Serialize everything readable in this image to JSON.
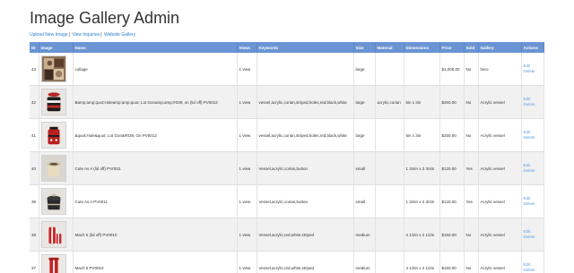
{
  "page": {
    "title": "Image Gallery Admin",
    "nav": {
      "upload": "Upload New Image",
      "inquiries": "View Inquiries",
      "website": "Website Gallery",
      "sep": "|"
    }
  },
  "table": {
    "headers": [
      "ID",
      "Image",
      "Name",
      "Views",
      "Keywords",
      "Size",
      "Material",
      "Dimensions",
      "Price",
      "Sold",
      "Gallery",
      "Actions"
    ],
    "rows": [
      {
        "id": "43",
        "name": "collage",
        "views": "1 view",
        "keywords": "",
        "size": "large",
        "material": "",
        "dimensions": "",
        "price": "$1,000.00",
        "sold": "No",
        "gallery": "hero",
        "edit": "Edit",
        "delete": "Delete",
        "thumb": "collage-thumbnail"
      },
      {
        "id": "42",
        "name": "Bamp;amp;quot;Holeamp;amp;quot; Lot Gonamp;amp;#039; on (lid off) PV0012",
        "views": "1 view",
        "keywords": "vessel,acrylic,corian,striped,holes,red,black,white",
        "size": "large",
        "material": "acrylic,corian",
        "dimensions": "5in x 3in",
        "price": "$250.00",
        "sold": "No",
        "gallery": "Acrylic vessel",
        "edit": "Edit",
        "delete": "Delete",
        "thumb": "striped-vessel-lid-off-thumbnail"
      },
      {
        "id": "41",
        "name": "&quot;Hole&quot; Lot Gon&#039; On PV0012",
        "views": "1 view",
        "keywords": "vessel,acrylic,corian,striped,holes,red,black,white",
        "size": "large",
        "material": "",
        "dimensions": "5in x 3in",
        "price": "$250.00",
        "sold": "No",
        "gallery": "Acrylic vessel",
        "edit": "Edit",
        "delete": "Delete",
        "thumb": "red-vessel-thumbnail"
      },
      {
        "id": "40",
        "name": "Cute As A (lid off) PV0011",
        "views": "1 view",
        "keywords": "Vessel,acrylic,corian,button",
        "size": "small",
        "material": "",
        "dimensions": "1 3/4in x 2 3/4in",
        "price": "$120.00",
        "sold": "Yes",
        "gallery": "Acrylic vessel",
        "edit": "Edit",
        "delete": "Delete",
        "thumb": "cream-vessel-thumbnail"
      },
      {
        "id": "39",
        "name": "Cute As A PV0011",
        "views": "1 view",
        "keywords": "Vessel,acrylic,corian,button",
        "size": "small",
        "material": "",
        "dimensions": "1 3/4in x 2 3/4in",
        "price": "$120.00",
        "sold": "Yes",
        "gallery": "Acrylic vessel",
        "edit": "Edit",
        "delete": "Delete",
        "thumb": "dark-vessel-thumbnail"
      },
      {
        "id": "38",
        "name": "Mach 5 (lid off) PV0010",
        "views": "1 view",
        "keywords": "Vessel,acrylic,red,white,striped",
        "size": "medium",
        "material": "",
        "dimensions": "4 1/2in x 2 1/2in",
        "price": "$150.00",
        "sold": "No",
        "gallery": "Acrylic vessel",
        "edit": "Edit",
        "delete": "Delete",
        "thumb": "red-white-vessel-lid-off-thumbnail"
      },
      {
        "id": "37",
        "name": "Mach 5 PV0010",
        "views": "1 view",
        "keywords": "Vessel,acrylic,red,white,striped",
        "size": "medium",
        "material": "",
        "dimensions": "4 1/2in x 2 1/2in",
        "price": "$150.00",
        "sold": "No",
        "gallery": "Acrylic vessel",
        "edit": "Edit",
        "delete": "Delete",
        "thumb": "red-white-vessel-thumbnail"
      }
    ]
  },
  "colors": {
    "header_bg": "#6a94d3",
    "link": "#2f7fd1",
    "action_link": "#5aa0e6",
    "alt_row": "#f1f1f1"
  }
}
